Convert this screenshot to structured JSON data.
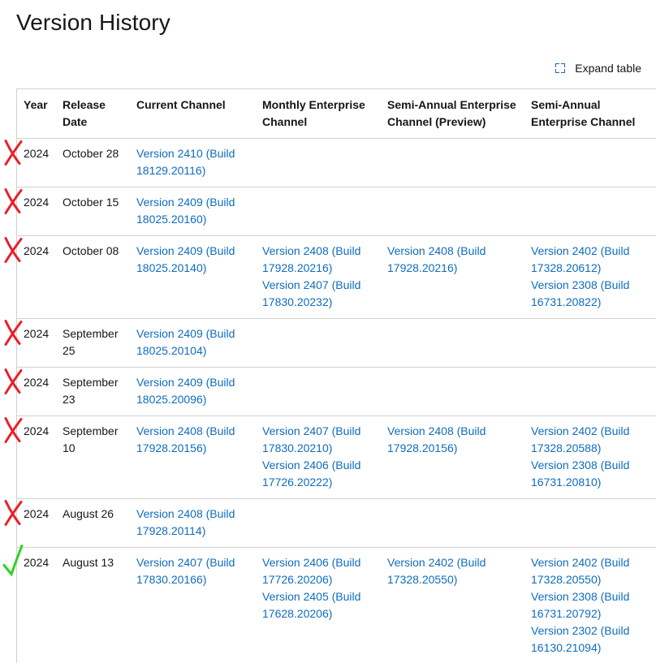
{
  "page": {
    "title": "Version History",
    "expand_label": "Expand table"
  },
  "table": {
    "headers": [
      "Year",
      "Release Date",
      "Current Channel",
      "Monthly Enterprise Channel",
      "Semi-Annual Enterprise Channel (Preview)",
      "Semi-Annual Enterprise Channel"
    ],
    "rows": [
      {
        "year": "2024",
        "date": "October 28",
        "current": [
          "Version 2410 (Build 18129.20116)"
        ],
        "monthly": [],
        "sa_preview": [],
        "sa": []
      },
      {
        "year": "2024",
        "date": "October 15",
        "current": [
          "Version 2409 (Build 18025.20160)"
        ],
        "monthly": [],
        "sa_preview": [],
        "sa": []
      },
      {
        "year": "2024",
        "date": "October 08",
        "current": [
          "Version 2409 (Build 18025.20140)"
        ],
        "monthly": [
          "Version 2408 (Build 17928.20216)",
          "Version 2407 (Build 17830.20232)"
        ],
        "sa_preview": [
          "Version 2408 (Build 17928.20216)"
        ],
        "sa": [
          "Version 2402 (Build 17328.20612)",
          "Version 2308 (Build 16731.20822)"
        ]
      },
      {
        "year": "2024",
        "date": "September 25",
        "current": [
          "Version 2409 (Build 18025.20104)"
        ],
        "monthly": [],
        "sa_preview": [],
        "sa": []
      },
      {
        "year": "2024",
        "date": "September 23",
        "current": [
          "Version 2409 (Build 18025.20096)"
        ],
        "monthly": [],
        "sa_preview": [],
        "sa": []
      },
      {
        "year": "2024",
        "date": "September 10",
        "current": [
          "Version 2408 (Build 17928.20156)"
        ],
        "monthly": [
          "Version 2407 (Build 17830.20210)",
          "Version 2406 (Build 17726.20222)"
        ],
        "sa_preview": [
          "Version 2408 (Build 17928.20156)"
        ],
        "sa": [
          "Version 2402 (Build 17328.20588)",
          "Version 2308 (Build 16731.20810)"
        ]
      },
      {
        "year": "2024",
        "date": "August 26",
        "current": [
          "Version 2408 (Build 17928.20114)"
        ],
        "monthly": [],
        "sa_preview": [],
        "sa": []
      },
      {
        "year": "2024",
        "date": "August 13",
        "current": [
          "Version 2407 (Build 17830.20166)"
        ],
        "monthly": [
          "Version 2406 (Build 17726.20206)",
          "Version 2405 (Build 17628.20206)"
        ],
        "sa_preview": [
          "Version 2402 (Build 17328.20550)"
        ],
        "sa": [
          "Version 2402 (Build 17328.20550)",
          "Version 2308 (Build 16731.20792)",
          "Version 2302 (Build 16130.21094)"
        ]
      }
    ]
  },
  "annotations": {
    "marks": [
      "cross",
      "cross",
      "cross",
      "cross",
      "cross",
      "cross",
      "cross",
      "check"
    ],
    "cross_color": "#e8202a",
    "check_color": "#2bd41e"
  },
  "colors": {
    "link": "#0f6cbd",
    "border": "#d1d1d1",
    "text": "#161616"
  }
}
